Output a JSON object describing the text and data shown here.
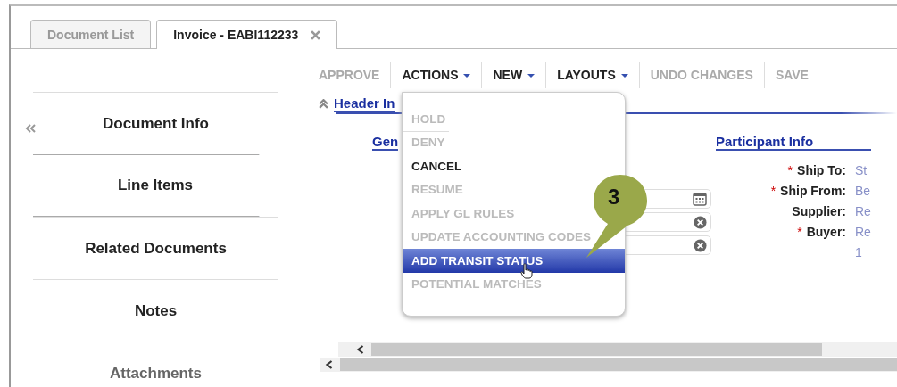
{
  "tabs": [
    {
      "label": "Document List",
      "selected": false,
      "closable": false
    },
    {
      "label": "Invoice - EABI112233",
      "selected": true,
      "closable": true
    }
  ],
  "sidebar": {
    "items": [
      {
        "label": "Document Info",
        "selected": false
      },
      {
        "label": "Line Items",
        "selected": true
      },
      {
        "label": "Related Documents",
        "selected": false
      },
      {
        "label": "Notes",
        "selected": false
      },
      {
        "label": "Attachments",
        "selected": false
      }
    ]
  },
  "toolbar": [
    {
      "label": "APPROVE",
      "disabled": true,
      "menu": false
    },
    {
      "label": "ACTIONS",
      "disabled": false,
      "menu": true
    },
    {
      "label": "NEW",
      "disabled": false,
      "menu": true
    },
    {
      "label": "LAYOUTS",
      "disabled": false,
      "menu": true
    },
    {
      "label": "UNDO CHANGES",
      "disabled": true,
      "menu": false
    },
    {
      "label": "SAVE",
      "disabled": true,
      "menu": false
    }
  ],
  "actions_menu": [
    {
      "label": "HOLD",
      "disabled": true,
      "selected": false
    },
    {
      "label": "DENY",
      "disabled": true,
      "selected": false
    },
    {
      "label": "CANCEL",
      "disabled": false,
      "selected": false
    },
    {
      "label": "RESUME",
      "disabled": true,
      "selected": false
    },
    {
      "label": "APPLY GL RULES",
      "disabled": true,
      "selected": false
    },
    {
      "label": "UPDATE ACCOUNTING CODES",
      "disabled": true,
      "selected": false
    },
    {
      "label": "ADD TRANSIT STATUS",
      "disabled": false,
      "selected": true
    },
    {
      "label": "POTENTIAL MATCHES",
      "disabled": true,
      "selected": false
    }
  ],
  "header_section": "Header In",
  "general_section": "Gen",
  "fields": [
    {
      "kind": "date"
    },
    {
      "kind": "clearable"
    },
    {
      "kind": "clearable"
    }
  ],
  "participant_info": {
    "title": "Participant Info",
    "rows": [
      {
        "required_mark": "*",
        "label": "Ship To:",
        "value": "St"
      },
      {
        "required_mark": "*",
        "label": "Ship From:",
        "value": "Be"
      },
      {
        "label": "Supplier:",
        "value": "Re"
      },
      {
        "required_mark": "*",
        "label": "Buyer:",
        "value": "Re"
      },
      {
        "value": "1"
      }
    ]
  },
  "callout": "3"
}
